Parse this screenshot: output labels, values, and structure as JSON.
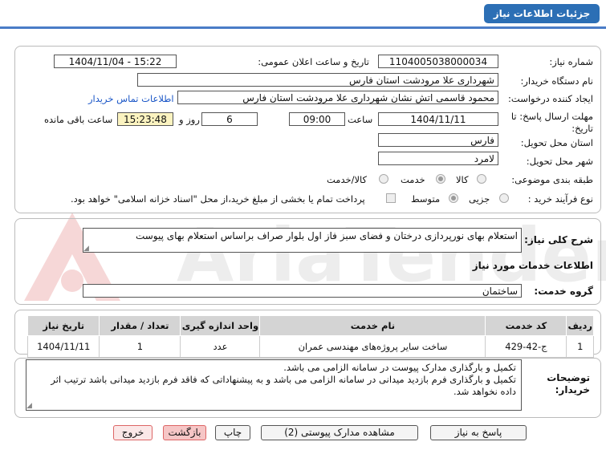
{
  "header": {
    "title": "جزئیات اطلاعات نیاز"
  },
  "watermark": {
    "text": "AriaTender.net"
  },
  "info": {
    "need_number_label": "شماره نیاز:",
    "need_number": "1104005038000034",
    "announce_label": "تاریخ و ساعت اعلان عمومی:",
    "announce_value": "1404/11/04 - 15:22",
    "buyer_label": "نام دستگاه خریدار:",
    "buyer_value": "شهرداری علا مرودشت استان فارس",
    "creator_label": "ایجاد کننده درخواست:",
    "creator_value": "محمود قاسمی اتش نشان شهرداری علا مرودشت استان فارس",
    "contact_link": "اطلاعات تماس خریدار",
    "deadline_label_1": "مهلت ارسال پاسخ: تا",
    "deadline_label_2": "تاریخ:",
    "deadline_date": "1404/11/11",
    "time_label": "ساعت",
    "deadline_time": "09:00",
    "days_value": "6",
    "days_label": "روز و",
    "remaining_time": "15:23:48",
    "remaining_label": "ساعت باقی مانده",
    "province_label": "استان محل تحویل:",
    "province_value": "فارس",
    "city_label": "شهر محل تحویل:",
    "city_value": "لامرد",
    "category_label": "طبقه بندی موضوعی:",
    "category_options": [
      "کالا",
      "خدمت",
      "کالا/خدمت"
    ],
    "category_selected": "خدمت",
    "process_label": "نوع فرآیند خرید :",
    "process_options": [
      "جزیی",
      "متوسط"
    ],
    "process_selected": "متوسط",
    "payment_note": "پرداخت تمام یا بخشی از مبلغ خرید،از محل \"اسناد خزانه اسلامی\" خواهد بود."
  },
  "summary": {
    "label": "شرح کلی نیاز:",
    "value": "استعلام بهای نورپردازی درختان و فضای سبز فاز اول بلوار صراف براساس استعلام بهای پیوست"
  },
  "services": {
    "section_title": "اطلاعات خدمات مورد نیاز",
    "group_label": "گروه خدمت:",
    "group_value": "ساختمان",
    "columns": [
      "ردیف",
      "کد خدمت",
      "نام خدمت",
      "واحد اندازه گیری",
      "تعداد / مقدار",
      "تاریخ نیاز"
    ],
    "rows": [
      [
        "1",
        "ج-42-429",
        "ساخت سایر پروژه‌های مهندسی عمران",
        "عدد",
        "1",
        "1404/11/11"
      ]
    ]
  },
  "notes": {
    "label_1": "توضیحات",
    "label_2": "خریدار:",
    "lines": [
      "تکمیل و بارگذاری مدارک پیوست در سامانه الزامی می باشد.",
      "تکمیل و بارگذاری فرم بازدید میدانی در سامانه الزامی می باشد و به پیشنهاداتی که فاقد فرم بازدید میدانی باشد ترتیب اثر",
      "داده نخواهد شد."
    ]
  },
  "buttons": {
    "reply": "پاسخ به نیاز",
    "view_docs": "مشاهده مدارک پیوستی (2)",
    "print": "چاپ",
    "back": "بازگشت",
    "exit": "خروج"
  },
  "colors": {
    "header_blue": "#2c6fb5",
    "highlight_yellow": "#fbf3c0",
    "link_blue": "#1a56c7",
    "exit_red": "#d66"
  }
}
